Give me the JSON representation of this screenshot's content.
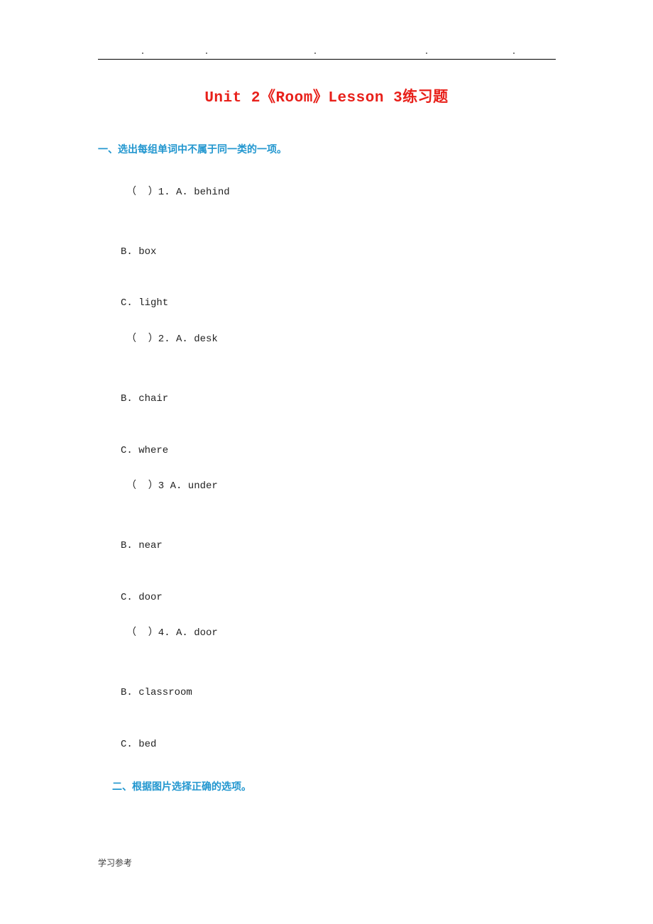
{
  "document": {
    "title_prefix": "Unit 2",
    "title_full": "Unit 2《Room》Lesson 3练习题",
    "footer": "学习参考",
    "header_rule_ticks": 5,
    "colors": {
      "title": "#e8201a",
      "section": "#2196cf",
      "body": "#222222",
      "rule": "#000000"
    }
  },
  "sections": [
    {
      "heading": "一、选出每组单词中不属于同一类的一项。",
      "items": [
        "（  ）1. A. behind",
        "B. box",
        "C. light",
        "（  ）2. A. desk",
        "B. chair",
        "C. where",
        "（  ）3 A. under",
        "B. near",
        "C. door",
        "（  ）4. A. door",
        "B. classroom",
        "C. bed"
      ]
    },
    {
      "heading": "二、根据图片选择正确的选项。",
      "items": []
    }
  ]
}
